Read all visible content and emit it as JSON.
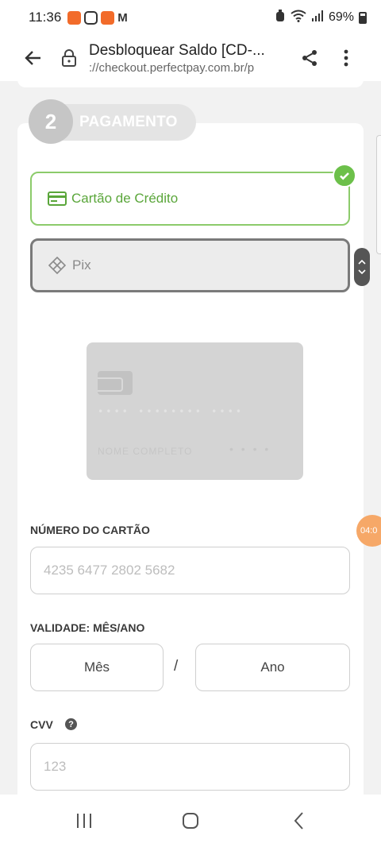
{
  "status_bar": {
    "time": "11:36",
    "battery": "69%",
    "battery_level": 0.69
  },
  "browser": {
    "page_title": "Desbloquear Saldo [CD-...",
    "url": "://checkout.perfectpay.com.br/p"
  },
  "payment": {
    "step_number": "2",
    "step_label": "PAGAMENTO",
    "options": [
      {
        "label": "Cartão de Crédito",
        "icon": "credit-card-icon",
        "selected": true
      },
      {
        "label": "Pix",
        "icon": "pix-icon",
        "selected": false
      }
    ],
    "card_preview": {
      "number": "•••• •••••••• ••••",
      "holder": "NOME COMPLETO",
      "brand": "• • • •"
    },
    "card_number": {
      "label": "NÚMERO DO CARTÃO",
      "placeholder": "4235 6477 2802 5682"
    },
    "validity": {
      "label": "VALIDADE: MÊS/ANO",
      "month": "Mês",
      "separator": "/",
      "year": "Ano"
    },
    "cvv": {
      "label": "CVV",
      "placeholder": "123",
      "help_icon": "question-circle-icon"
    }
  },
  "timer_badge": "04:0",
  "colors": {
    "accent_green": "#6cc04a",
    "timer_orange": "#f6a868"
  }
}
